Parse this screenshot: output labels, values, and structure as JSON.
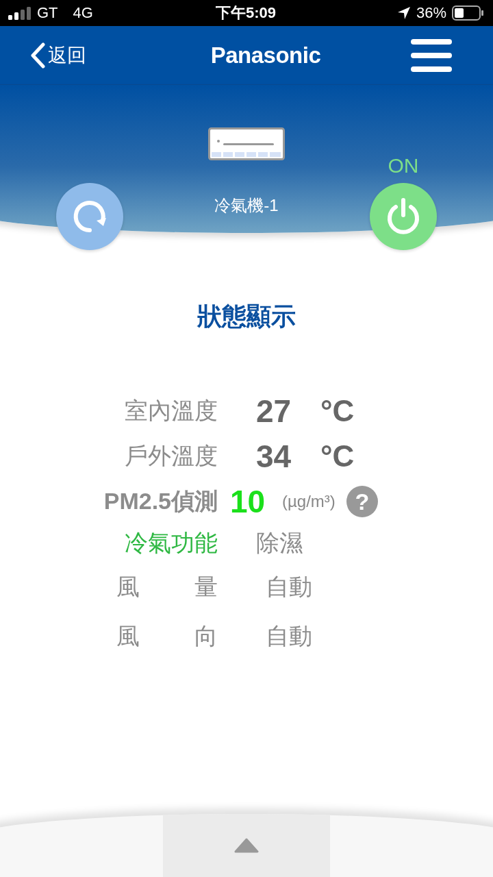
{
  "status_bar": {
    "carrier": "GT",
    "network": "4G",
    "time": "下午5:09",
    "battery": "36%"
  },
  "header": {
    "back": "返回",
    "logo": "Panasonic"
  },
  "device": {
    "name": "冷氣機-1",
    "power_label": "ON",
    "power_on": true
  },
  "section_title": "狀態顯示",
  "rows": [
    {
      "kind": "reading",
      "label": "室內溫度",
      "value": "27",
      "unit": "°C"
    },
    {
      "kind": "reading",
      "label": "戶外溫度",
      "value": "34",
      "unit": "°C"
    },
    {
      "kind": "pm",
      "label": "PM2.5偵測",
      "value": "10",
      "unit": "(µg/m³)",
      "help": "?"
    },
    {
      "kind": "mode",
      "label": "冷氣功能",
      "value": "除濕"
    },
    {
      "kind": "setting",
      "label": "風量",
      "value": "自動"
    },
    {
      "kind": "setting",
      "label": "風向",
      "value": "自動"
    }
  ]
}
